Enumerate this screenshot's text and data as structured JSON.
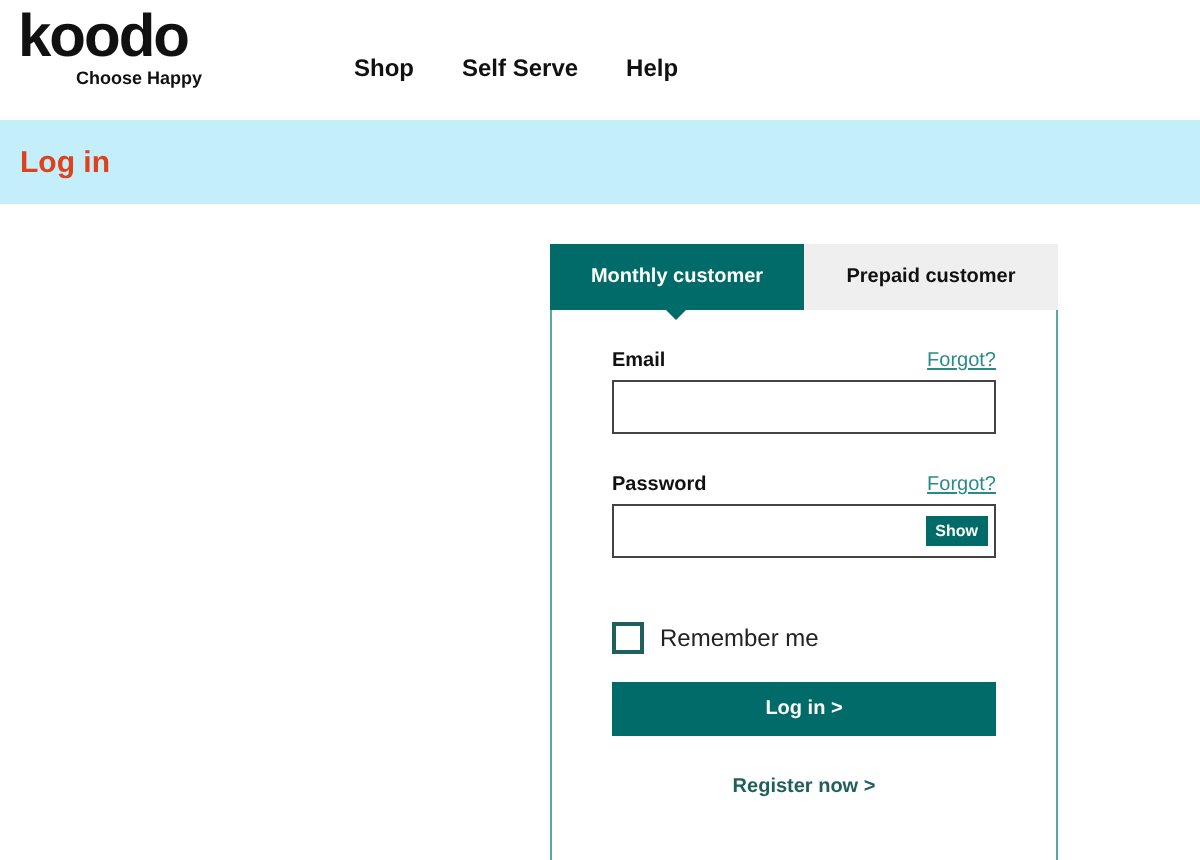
{
  "header": {
    "logo": "koodo",
    "tagline": "Choose Happy",
    "nav": [
      "Shop",
      "Self Serve",
      "Help"
    ]
  },
  "banner": {
    "title": "Log in"
  },
  "tabs": [
    {
      "label": "Monthly customer",
      "selected": true
    },
    {
      "label": "Prepaid customer",
      "selected": false
    }
  ],
  "form": {
    "email": {
      "label": "Email",
      "forgot": "Forgot?"
    },
    "password": {
      "label": "Password",
      "forgot": "Forgot?",
      "show": "Show"
    },
    "remember": {
      "label": "Remember me",
      "checked": false
    },
    "submit": "Log in >",
    "register": "Register now >"
  }
}
